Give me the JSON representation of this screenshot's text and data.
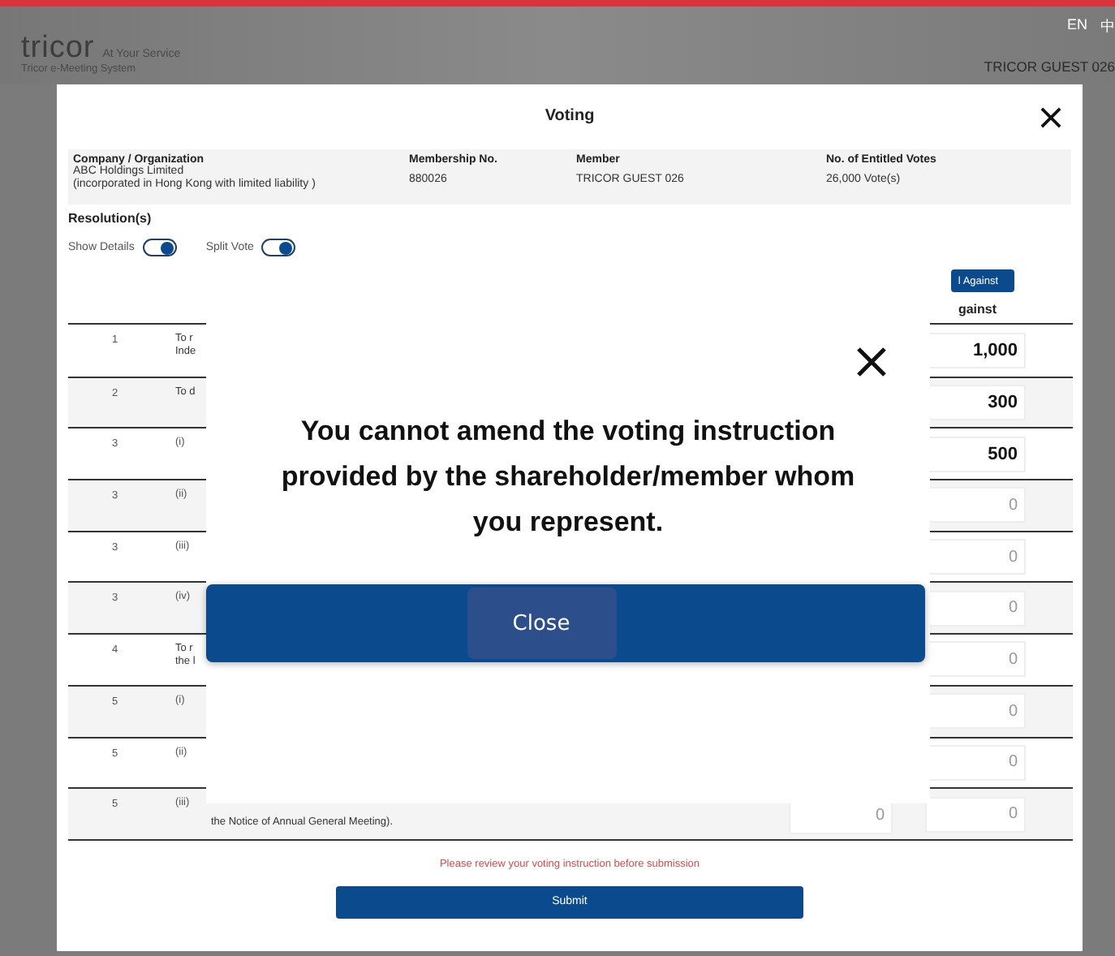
{
  "header": {
    "logo": "tricor",
    "tagline": "At Your Service",
    "subtitle": "Tricor e-Meeting System",
    "languages": [
      "EN",
      "中"
    ],
    "user": "TRICOR GUEST 026"
  },
  "dialog": {
    "title": "Voting",
    "info": [
      {
        "label": "Company / Organization",
        "lines": [
          "ABC Holdings Limited",
          "(incorporated in Hong Kong with limited liability )"
        ]
      },
      {
        "label": "Membership No.",
        "lines": [
          "880026"
        ]
      },
      {
        "label": "Member",
        "lines": [
          "TRICOR GUEST 026"
        ]
      },
      {
        "label": "No. of Entitled Votes",
        "lines": [
          "26,000 Vote(s)"
        ]
      }
    ],
    "section": "Resolution(s)",
    "toggles": [
      {
        "label": "Show Details",
        "on": true
      },
      {
        "label": "Split Vote",
        "on": true
      }
    ],
    "all_against_button": "l Against",
    "against_header": "gainst",
    "rows": [
      {
        "number": "1",
        "text": [
          "To r",
          "Inde"
        ],
        "against": "1,000",
        "entered": true
      },
      {
        "number": "2",
        "text": [
          "To d"
        ],
        "against": "300",
        "entered": true
      },
      {
        "number": "3",
        "item": "(i)",
        "against": "500",
        "entered": true
      },
      {
        "number": "3",
        "item": "(ii)",
        "against": "0",
        "entered": false
      },
      {
        "number": "3",
        "item": "(iii)",
        "against": "0",
        "entered": false
      },
      {
        "number": "3",
        "item": "(iv)",
        "against": "0",
        "entered": false
      },
      {
        "number": "4",
        "text": [
          "To r",
          "the l"
        ],
        "against": "0",
        "entered": false
      },
      {
        "number": "5",
        "item": "(i)",
        "against": "0",
        "entered": false
      },
      {
        "number": "5",
        "item": "(ii)",
        "against": "0",
        "entered": false
      },
      {
        "number": "5",
        "item": "(iii)",
        "text": [
          "the Notice of Annual General Meeting)."
        ],
        "for": "0",
        "against": "0",
        "entered": false
      }
    ],
    "notice": "Please review your voting instruction before submission",
    "submit": "Submit"
  },
  "popup": {
    "message": "You cannot amend the voting instruction provided by the shareholder/member whom you represent.",
    "button": "Close"
  }
}
